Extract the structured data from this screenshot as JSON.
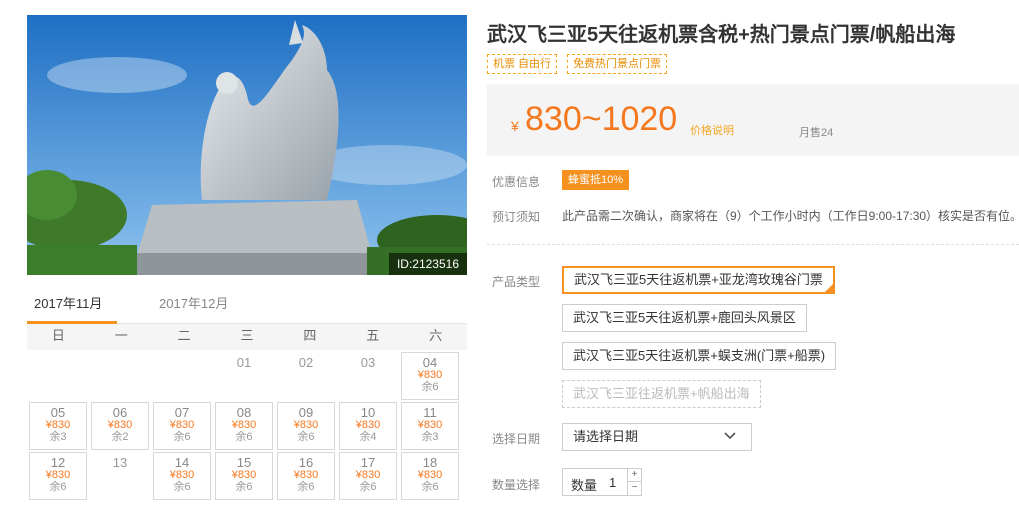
{
  "product": {
    "title": "武汉飞三亚5天往返机票含税+热门景点门票/帆船出海",
    "tags": [
      "机票 自由行",
      "免费热门景点门票"
    ],
    "image_id": "ID:2123516"
  },
  "price": {
    "currency": "¥",
    "range": "830~1020",
    "note": "价格说明",
    "monthly_sales": "月售24"
  },
  "promo": {
    "label": "优惠信息",
    "badge": "蜂蜜抵10%"
  },
  "booking": {
    "label": "预订须知",
    "text": "此产品需二次确认，商家将在（9）个工作小时内（工作日9:00-17:30）核实是否有位。"
  },
  "product_type": {
    "label": "产品类型",
    "options": [
      {
        "text": "武汉飞三亚5天往返机票+亚龙湾玫瑰谷门票",
        "state": "selected"
      },
      {
        "text": "武汉飞三亚5天往返机票+鹿回头风景区",
        "state": "normal"
      },
      {
        "text": "武汉飞三亚5天往返机票+蜈支洲(门票+船票)",
        "state": "normal"
      },
      {
        "text": "武汉飞三亚往返机票+帆船出海",
        "state": "disabled"
      }
    ]
  },
  "date": {
    "label": "选择日期",
    "placeholder": "请选择日期"
  },
  "quantity": {
    "label": "数量选择",
    "inner_label": "数量",
    "value": "1",
    "plus": "+",
    "minus": "−"
  },
  "calendar": {
    "tabs": [
      "2017年11月",
      "2017年12月"
    ],
    "weekdays": [
      "日",
      "一",
      "二",
      "三",
      "四",
      "五",
      "六"
    ],
    "rows": [
      [
        {
          "day": ""
        },
        {
          "day": ""
        },
        {
          "day": ""
        },
        {
          "day": "01"
        },
        {
          "day": "02"
        },
        {
          "day": "03"
        },
        {
          "day": "04",
          "price": "¥830",
          "stock": "余6"
        }
      ],
      [
        {
          "day": "05",
          "price": "¥830",
          "stock": "余3"
        },
        {
          "day": "06",
          "price": "¥830",
          "stock": "余2"
        },
        {
          "day": "07",
          "price": "¥830",
          "stock": "余6"
        },
        {
          "day": "08",
          "price": "¥830",
          "stock": "余6"
        },
        {
          "day": "09",
          "price": "¥830",
          "stock": "余6"
        },
        {
          "day": "10",
          "price": "¥830",
          "stock": "余4"
        },
        {
          "day": "11",
          "price": "¥830",
          "stock": "余3"
        }
      ],
      [
        {
          "day": "12",
          "price": "¥830",
          "stock": "余6"
        },
        {
          "day": "13"
        },
        {
          "day": "14",
          "price": "¥830",
          "stock": "余6"
        },
        {
          "day": "15",
          "price": "¥830",
          "stock": "余6"
        },
        {
          "day": "16",
          "price": "¥830",
          "stock": "余6"
        },
        {
          "day": "17",
          "price": "¥830",
          "stock": "余6"
        },
        {
          "day": "18",
          "price": "¥830",
          "stock": "余6"
        }
      ]
    ]
  },
  "colors": {
    "accent": "#f5911e",
    "price": "#f5781e",
    "sky": "#2a7fd0"
  }
}
